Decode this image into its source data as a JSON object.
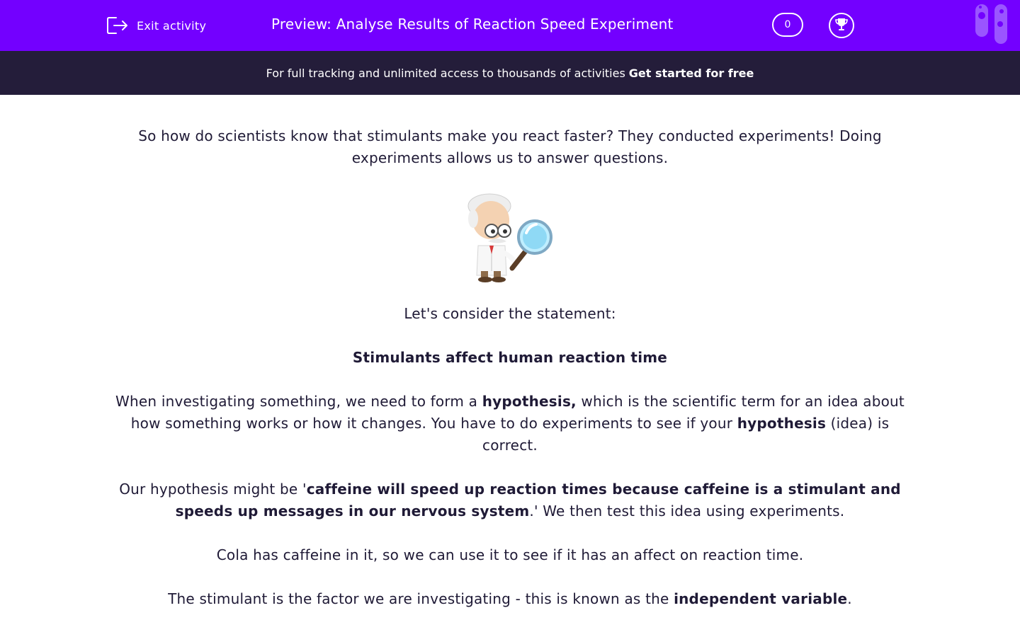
{
  "header": {
    "exit_label": "Exit activity",
    "title": "Preview: Analyse Results of Reaction Speed Experiment",
    "score": "0",
    "icons": [
      "exit-icon",
      "trophy-icon",
      "test-tubes-icon"
    ],
    "brand_color": "#7300ff"
  },
  "banner": {
    "text": "For full tracking and unlimited access to thousands of activities",
    "cta": "Get started for free",
    "bg_color": "#241d3a"
  },
  "content": {
    "intro": "So how do scientists know that stimulants make you react faster?  They conducted experiments! Doing experiments allows us to answer questions.",
    "consider": "Let's consider the statement:",
    "statement": "Stimulants affect human reaction time",
    "hyp_p1": "When investigating something, we need to form a ",
    "hyp_b1": "hypothesis,",
    "hyp_p2": " which is the scientific term for an idea about how something works or how it changes. You have to do experiments to see if your ",
    "hyp_b2": "hypothesis",
    "hyp_p3": " (idea) is correct.",
    "our_p1": "Our hypothesis might be '",
    "our_b": "caffeine will speed up reaction times because caffeine is a stimulant and speeds up messages in our nervous system",
    "our_p2": ".'  We then test this idea using experiments.",
    "cola": "Cola has caffeine in it, so we can use it to see if it has an affect on reaction time.",
    "ind_p1": "The stimulant is the factor we are investigating - this is known as the ",
    "ind_b": "independent variable",
    "ind_p2": "."
  },
  "illustration": "scientist-with-magnifying-glass"
}
